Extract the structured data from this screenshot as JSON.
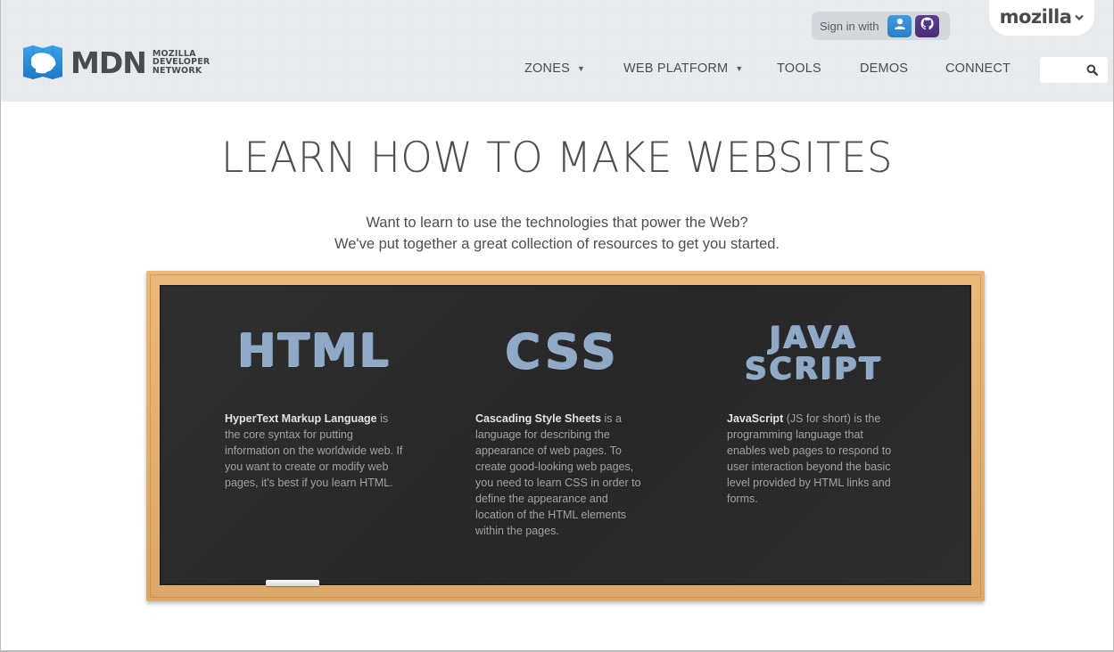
{
  "header": {
    "logo": {
      "wordmark": "MDN",
      "subtitle_lines": [
        "MOZILLA",
        "DEVELOPER",
        "NETWORK"
      ]
    },
    "signin": {
      "label": "Sign in with",
      "providers": [
        {
          "name": "Persona",
          "icon": "user-icon",
          "color": "#3590d3"
        },
        {
          "name": "GitHub",
          "icon": "github-icon",
          "color": "#553683"
        }
      ]
    },
    "mozilla_tab": {
      "label": "mozilla",
      "icon": "chevron-down-icon"
    },
    "nav": [
      {
        "label": "ZONES",
        "has_dropdown": true
      },
      {
        "label": "WEB PLATFORM",
        "has_dropdown": true
      },
      {
        "label": "TOOLS",
        "has_dropdown": false
      },
      {
        "label": "DEMOS",
        "has_dropdown": false
      },
      {
        "label": "CONNECT",
        "has_dropdown": false
      }
    ],
    "search": {
      "value": "",
      "placeholder": "",
      "icon": "search-icon"
    }
  },
  "main": {
    "title": "LEARN HOW TO MAKE WEBSITES",
    "subtitle_lines": [
      "Want to learn to use the technologies that power the Web?",
      "We've put together a great collection of resources to get you started."
    ],
    "chalkboard": {
      "columns": [
        {
          "chalk_title": [
            "HTML"
          ],
          "term": "HyperText Markup Language",
          "text": " is the core syntax for putting information on the worldwide web. If you want to create or modify web pages, it's best if you learn HTML."
        },
        {
          "chalk_title": [
            "CSS"
          ],
          "term": "Cascading Style Sheets",
          "text": " is a language for describing the appearance of web pages. To create good-looking web pages, you need to learn CSS in order to define the appearance and location of the HTML elements within the pages."
        },
        {
          "chalk_title": [
            "JAVA",
            "SCRIPT"
          ],
          "term": "JavaScript",
          "text": " (JS for short) is the programming language that enables web pages to respond to user interaction beyond the basic level provided by HTML links and forms."
        }
      ]
    }
  },
  "colors": {
    "header_bg": "#e6e9ec",
    "text": "#4d4e53",
    "chalk_blue": "#8fa9c6",
    "board": "#2b2b2c",
    "frame_wood": "#e3b173",
    "logo_blue": "#2f8fdc"
  }
}
